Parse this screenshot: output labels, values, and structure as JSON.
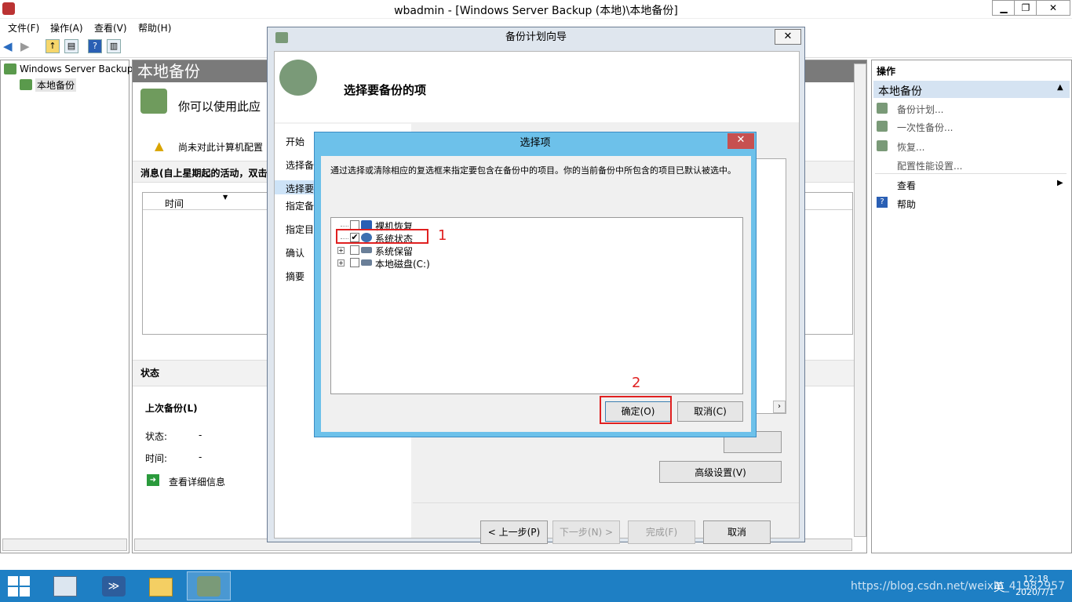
{
  "window": {
    "title": "wbadmin - [Windows Server Backup (本地)\\本地备份]",
    "min": "▁",
    "max": "❐",
    "close": "✕"
  },
  "menu": [
    "文件(F)",
    "操作(A)",
    "查看(V)",
    "帮助(H)"
  ],
  "tree": {
    "root": "Windows Server Backup",
    "child": "本地备份"
  },
  "center": {
    "header": "本地备份",
    "intro": "你可以使用此应",
    "warning": "尚未对此计算机配置",
    "messages_title": "消息(自上星期起的活动，双击",
    "col_time": "时间",
    "status_title": "状态",
    "last_backup": "上次备份(L)",
    "status_label": "状态:",
    "status_value": "-",
    "time_label": "时间:",
    "time_value": "-",
    "details_link": "查看详细信息"
  },
  "actions": {
    "title": "操作",
    "section": "本地备份",
    "items": [
      "备份计划...",
      "一次性备份...",
      "恢复...",
      "配置性能设置...",
      "查看",
      "帮助"
    ]
  },
  "wizard": {
    "title": "备份计划向导",
    "close": "✕",
    "heading": "选择要备份的项",
    "steps": [
      "开始",
      "选择备",
      "选择要",
      "指定备",
      "指定目",
      "确认",
      "摘要"
    ],
    "advanced": "高级设置(V)",
    "prev": "< 上一步(P)",
    "next": "下一步(N) >",
    "finish": "完成(F)",
    "cancel": "取消"
  },
  "dialog": {
    "title": "选择项",
    "close": "✕",
    "desc": "通过选择或清除相应的复选框来指定要包含在备份中的项目。你的当前备份中所包含的项目已默认被选中。",
    "items": [
      {
        "label": "裸机恢复",
        "checked": false
      },
      {
        "label": "系统状态",
        "checked": true
      },
      {
        "label": "系统保留",
        "checked": false
      },
      {
        "label": "本地磁盘(C:)",
        "checked": false
      }
    ],
    "ok": "确定(O)",
    "cancel": "取消(C)"
  },
  "annotations": {
    "one": "1",
    "two": "2"
  },
  "taskbar": {
    "time": "12:18",
    "date": "2020/7/1",
    "ime": "英",
    "watermark": "https://blog.csdn.net/weixin_41982957"
  },
  "colors": {
    "taskbar": "#1e7fc4",
    "dialog_frame": "#6dc1ea",
    "annotation": "#e02020"
  }
}
